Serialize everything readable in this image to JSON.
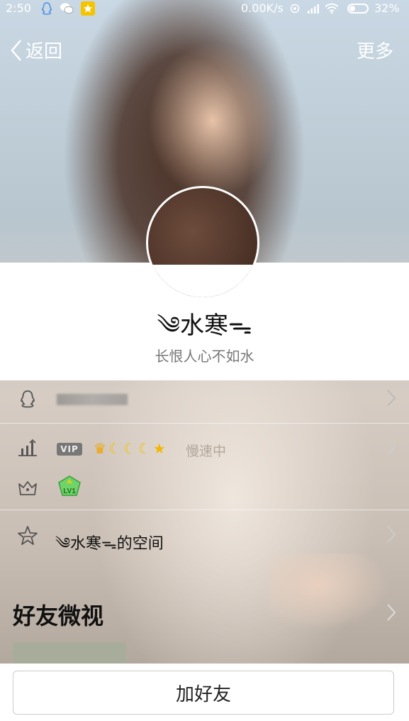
{
  "status_bar": {
    "time": "2:50",
    "network_speed": "0.00K/s",
    "battery_percent": "32%",
    "battery_level": 0.32,
    "icons": [
      "qq-icon",
      "wechat-icon",
      "star-app-icon",
      "sync-icon",
      "signal-icon",
      "wifi-icon",
      "battery-icon"
    ]
  },
  "nav": {
    "back_label": "返回",
    "more_label": "更多"
  },
  "profile": {
    "nickname": "༄水寒ᯓ",
    "signature": "长恨人心不如水"
  },
  "rows": {
    "vip": {
      "badge": "VIP",
      "status": "慢速中",
      "icons": [
        "crown-icon",
        "moon-icon",
        "moon-icon",
        "moon-icon",
        "star-icon"
      ]
    },
    "level": {
      "badge": "LV1"
    },
    "space": {
      "label": "༄水寒ᯓ的空间"
    }
  },
  "friends_videos": {
    "title": "好友微视"
  },
  "bottom": {
    "add_friend_label": "加好友"
  },
  "colors": {
    "vip_gold": "#f2b800",
    "muted_text": "#b3a79c"
  }
}
